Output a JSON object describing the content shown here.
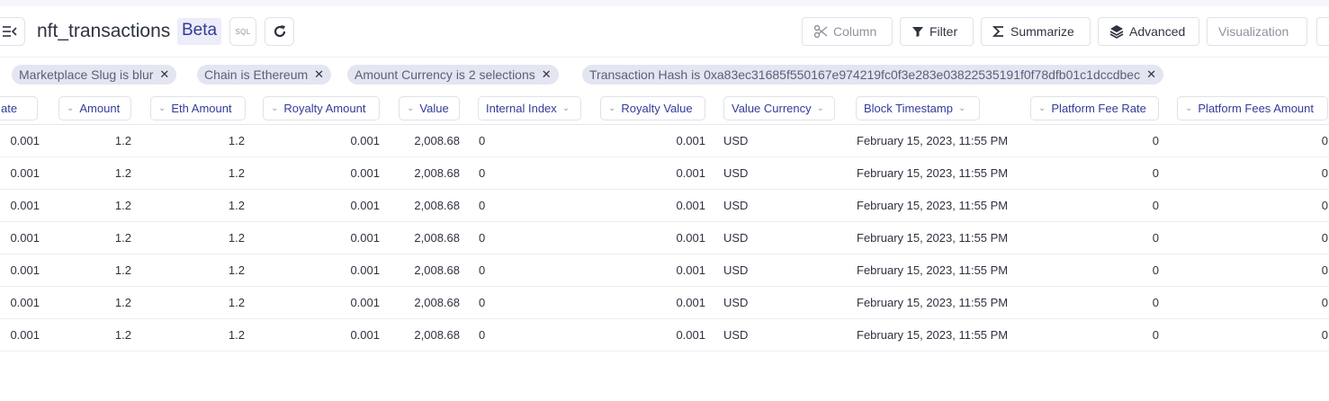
{
  "header": {
    "title": "nft_transactions",
    "badge": "Beta",
    "sql_label": "SQL",
    "buttons": {
      "column": "Column",
      "filter": "Filter",
      "summarize": "Summarize",
      "advanced": "Advanced",
      "visualization": "Visualization"
    }
  },
  "filters": [
    {
      "label": "Marketplace Slug is blur"
    },
    {
      "label": "Chain is Ethereum"
    },
    {
      "label": "Amount Currency is 2 selections"
    },
    {
      "label": "Transaction Hash is 0xa83ec31685f550167e974219fc0f3e283e03822535191f0f78dfb01c1dccdbec"
    }
  ],
  "table": {
    "columns": [
      "ate",
      "Amount",
      "Eth Amount",
      "Royalty Amount",
      "Value",
      "Internal Index",
      "Royalty Value",
      "Value Currency",
      "Block Timestamp",
      "Platform Fee Rate",
      "Platform Fees Amount"
    ],
    "rows": [
      [
        "0.001",
        "1.2",
        "1.2",
        "0.001",
        "2,008.68",
        "0",
        "0.001",
        "USD",
        "February 15, 2023, 11:55 PM",
        "0",
        "0"
      ],
      [
        "0.001",
        "1.2",
        "1.2",
        "0.001",
        "2,008.68",
        "0",
        "0.001",
        "USD",
        "February 15, 2023, 11:55 PM",
        "0",
        "0"
      ],
      [
        "0.001",
        "1.2",
        "1.2",
        "0.001",
        "2,008.68",
        "0",
        "0.001",
        "USD",
        "February 15, 2023, 11:55 PM",
        "0",
        "0"
      ],
      [
        "0.001",
        "1.2",
        "1.2",
        "0.001",
        "2,008.68",
        "0",
        "0.001",
        "USD",
        "February 15, 2023, 11:55 PM",
        "0",
        "0"
      ],
      [
        "0.001",
        "1.2",
        "1.2",
        "0.001",
        "2,008.68",
        "0",
        "0.001",
        "USD",
        "February 15, 2023, 11:55 PM",
        "0",
        "0"
      ],
      [
        "0.001",
        "1.2",
        "1.2",
        "0.001",
        "2,008.68",
        "0",
        "0.001",
        "USD",
        "February 15, 2023, 11:55 PM",
        "0",
        "0"
      ],
      [
        "0.001",
        "1.2",
        "1.2",
        "0.001",
        "2,008.68",
        "0",
        "0.001",
        "USD",
        "February 15, 2023, 11:55 PM",
        "0",
        "0"
      ]
    ]
  },
  "colors": {
    "accent": "#333b99",
    "chip_bg": "#e3e5f1",
    "beta_bg": "#ecedf8",
    "border": "#dfe2e8"
  },
  "icons": [
    "sidebar-toggle-icon",
    "refresh-icon",
    "scissors-icon",
    "filter-icon",
    "sigma-icon",
    "layers-icon",
    "close-icon",
    "chevron-down-icon"
  ]
}
